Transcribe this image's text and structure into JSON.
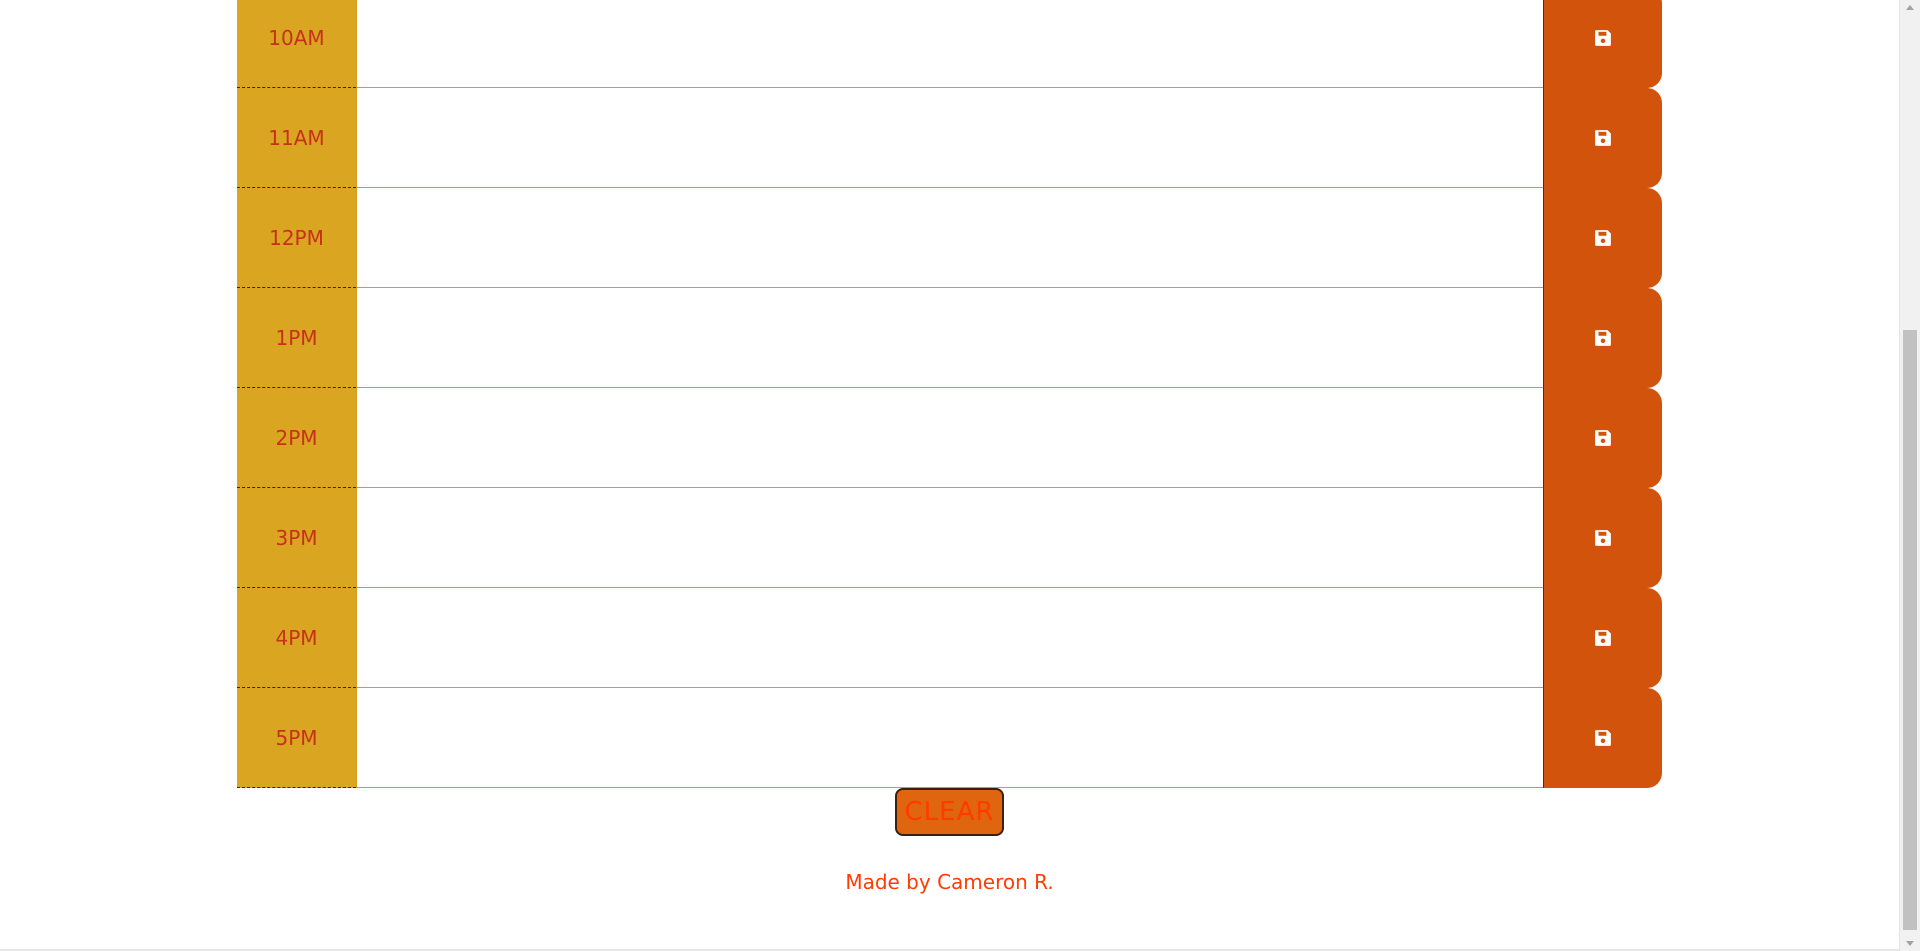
{
  "planner": {
    "rows": [
      {
        "hour": "10AM",
        "text": ""
      },
      {
        "hour": "11AM",
        "text": ""
      },
      {
        "hour": "12PM",
        "text": ""
      },
      {
        "hour": "1PM",
        "text": ""
      },
      {
        "hour": "2PM",
        "text": ""
      },
      {
        "hour": "3PM",
        "text": ""
      },
      {
        "hour": "4PM",
        "text": ""
      },
      {
        "hour": "5PM",
        "text": ""
      }
    ],
    "save_icon": "floppy-disk-icon"
  },
  "clear_label": "CLEAR",
  "footer": {
    "text": "Made by Cameron R."
  },
  "colors": {
    "hour_bg": "#daa520",
    "hour_text": "#c8301c",
    "save_bg": "#d1530c",
    "clear_bg": "#e0650f",
    "clear_text": "#ff3b00",
    "footer_text": "#ff3d00"
  }
}
